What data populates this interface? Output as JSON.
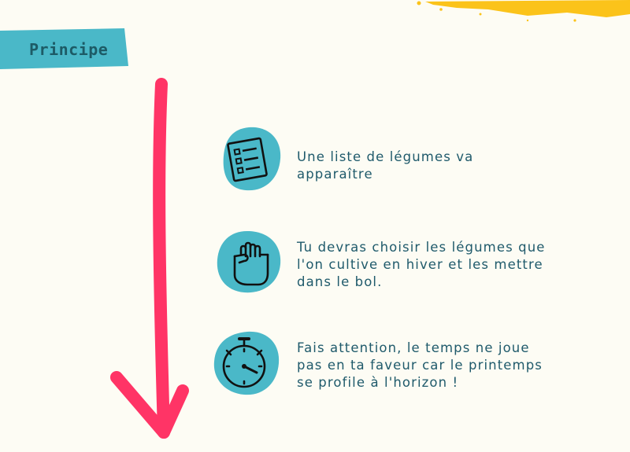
{
  "header": {
    "tag_label": "Principe"
  },
  "colors": {
    "accent_teal": "#4ab8c8",
    "arrow_pink": "#ff3466",
    "brush_yellow": "#fbc31a",
    "text": "#1f5a6b"
  },
  "steps": [
    {
      "icon": "checklist-icon",
      "text": "Une liste de légumes va\napparaître"
    },
    {
      "icon": "grab-hand-icon",
      "text": "Tu devras choisir les légumes que\nl'on cultive en hiver et les mettre\ndans le bol."
    },
    {
      "icon": "stopwatch-icon",
      "text": "Fais attention, le temps ne joue\npas en ta faveur car le printemps\nse profile à l'horizon !"
    }
  ]
}
